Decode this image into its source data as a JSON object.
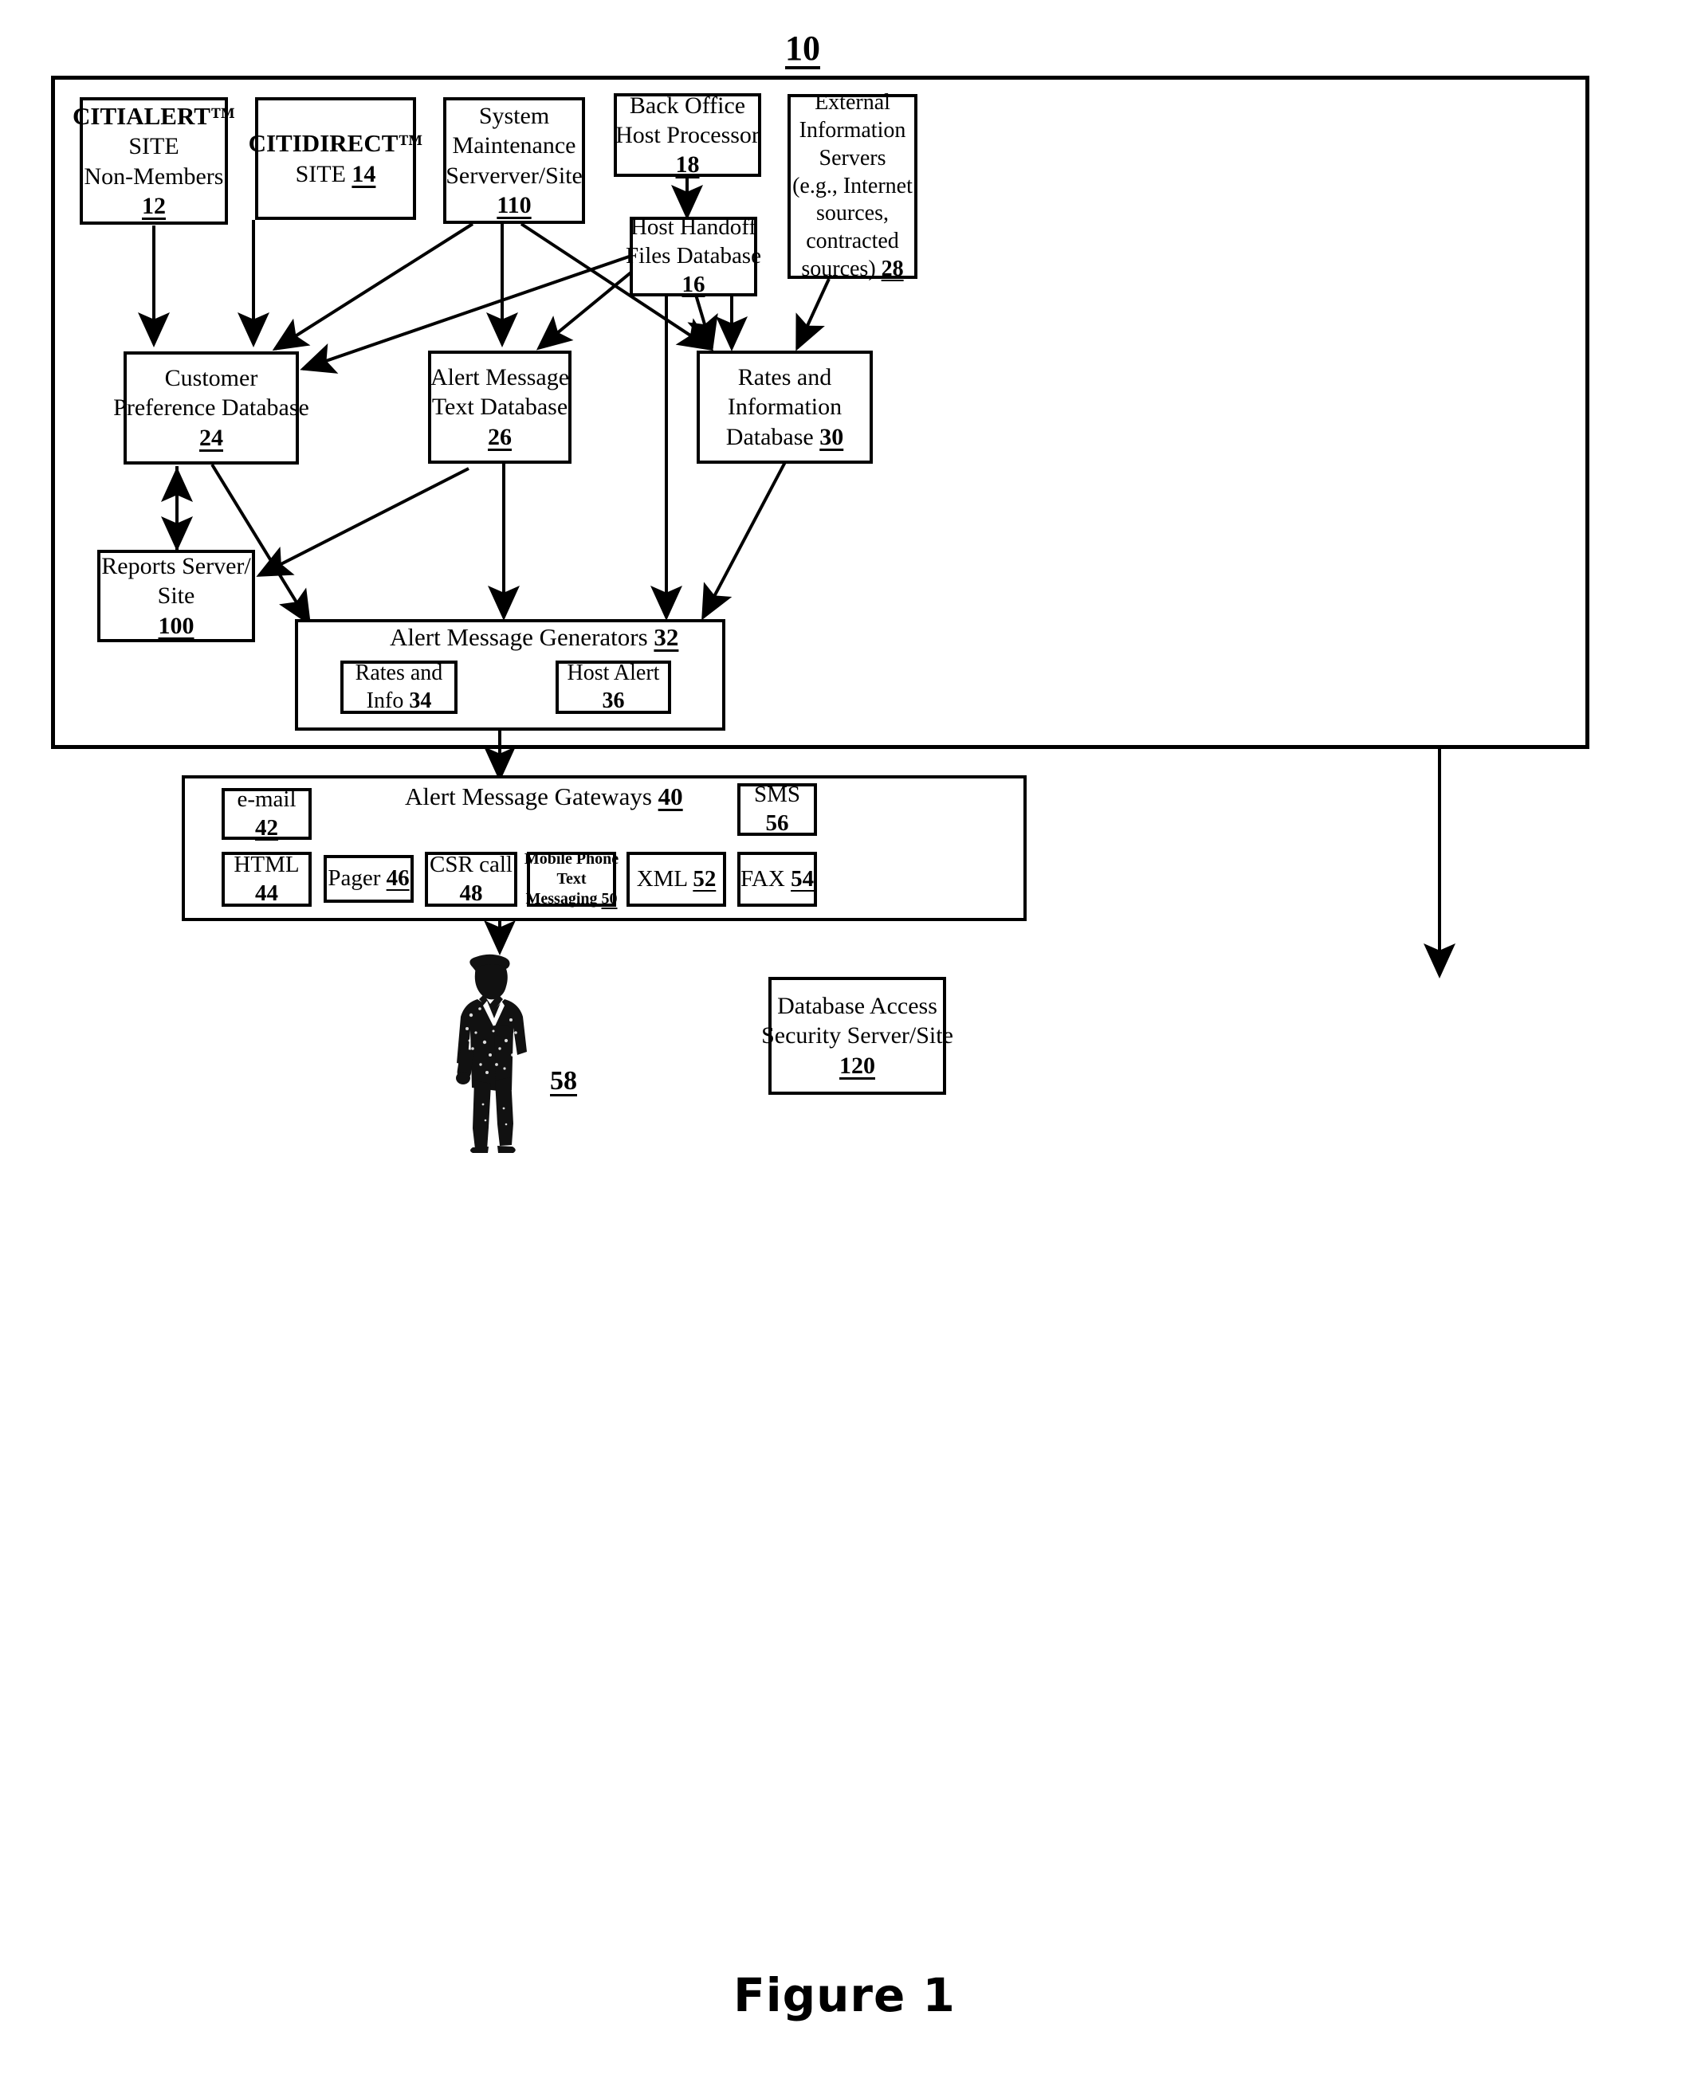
{
  "figure": {
    "caption": "Figure 1",
    "system_ref": "10"
  },
  "system_container": {
    "name": "system-boundary",
    "ref": "10"
  },
  "nodes": [
    {
      "id": "citialert",
      "lines": [
        "CITIALERT™",
        "SITE",
        "Non-Members"
      ],
      "ref": "12",
      "ref_inline": false,
      "bold_first": true
    },
    {
      "id": "citidirect",
      "lines": [
        "CITIDIRECT™",
        "SITE "
      ],
      "ref": "14",
      "ref_inline": true,
      "bold_first": true
    },
    {
      "id": "sys-maintenance",
      "lines": [
        "System",
        "Maintenance",
        "Serverver/Site"
      ],
      "ref": "110",
      "ref_inline": false,
      "bold_first": false
    },
    {
      "id": "back-office",
      "lines": [
        "Back Office",
        "Host Processor"
      ],
      "ref": "18",
      "ref_inline": false,
      "bold_first": false
    },
    {
      "id": "external-info",
      "lines": [
        "External",
        "Information",
        "Servers",
        "(e.g., Internet",
        "sources,",
        "contracted",
        "sources) "
      ],
      "ref": "28",
      "ref_inline": true,
      "bold_first": false
    },
    {
      "id": "host-handoff",
      "lines": [
        "Host Handoff",
        "Files Database"
      ],
      "ref": "16",
      "ref_inline": false,
      "bold_first": false
    },
    {
      "id": "customer-pref-db",
      "lines": [
        "Customer",
        "Preference Database"
      ],
      "ref": "24",
      "ref_inline": false,
      "bold_first": false
    },
    {
      "id": "alert-text-db",
      "lines": [
        "Alert Message",
        "Text Database"
      ],
      "ref": "26",
      "ref_inline": false,
      "bold_first": false
    },
    {
      "id": "rates-info-db",
      "lines": [
        "Rates and",
        "Information",
        "Database "
      ],
      "ref": "30",
      "ref_inline": true,
      "bold_first": false
    },
    {
      "id": "reports-server",
      "lines": [
        "Reports Server/",
        "Site"
      ],
      "ref": "100",
      "ref_inline": false,
      "bold_first": false
    },
    {
      "id": "rates-and-info",
      "lines": [
        "Rates and",
        "Info "
      ],
      "ref": "34",
      "ref_inline": true,
      "bold_first": false
    },
    {
      "id": "host-alert",
      "lines": [
        "Host Alert"
      ],
      "ref": "36",
      "ref_inline": false,
      "bold_first": false
    },
    {
      "id": "email",
      "lines": [
        "e-mail"
      ],
      "ref": "42",
      "ref_inline": false,
      "bold_first": false
    },
    {
      "id": "html",
      "lines": [
        "HTML"
      ],
      "ref": "44",
      "ref_inline": false,
      "bold_first": false
    },
    {
      "id": "pager",
      "lines": [
        "Pager "
      ],
      "ref": "46",
      "ref_inline": true,
      "bold_first": false
    },
    {
      "id": "csr-call",
      "lines": [
        "CSR call"
      ],
      "ref": "48",
      "ref_inline": false,
      "bold_first": false
    },
    {
      "id": "mobile-sms-text",
      "lines": [
        "Mobile Phone",
        "Text",
        "Messaging "
      ],
      "ref": "50",
      "ref_inline": true,
      "bold_first": false
    },
    {
      "id": "xml",
      "lines": [
        "XML "
      ],
      "ref": "52",
      "ref_inline": true,
      "bold_first": false
    },
    {
      "id": "fax",
      "lines": [
        "FAX "
      ],
      "ref": "54",
      "ref_inline": true,
      "bold_first": false
    },
    {
      "id": "sms",
      "lines": [
        "SMS"
      ],
      "ref": "56",
      "ref_inline": false,
      "bold_first": false
    },
    {
      "id": "db-access-sec",
      "lines": [
        "Database Access",
        "Security Server/Site"
      ],
      "ref": "120",
      "ref_inline": false,
      "bold_first": false
    }
  ],
  "panels": {
    "alert_generators": {
      "title": "Alert Message Generators ",
      "ref": "32"
    },
    "alert_gateways": {
      "title": "Alert Message Gateways ",
      "ref": "40"
    }
  },
  "actor": {
    "name": "customer-figure",
    "ref": "58",
    "description": "standing person in suit"
  },
  "colors": {
    "ink": "#000000",
    "paper": "#ffffff"
  }
}
